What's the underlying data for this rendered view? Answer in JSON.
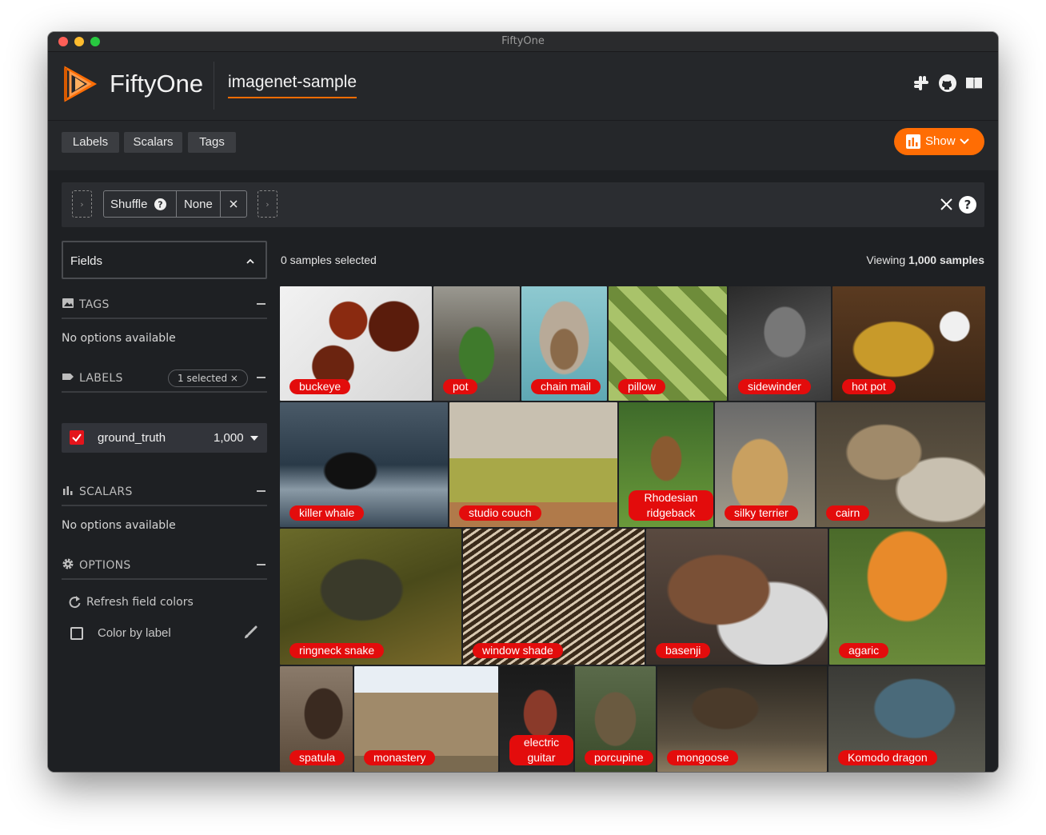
{
  "window": {
    "title": "FiftyOne"
  },
  "header": {
    "brand": "FiftyOne",
    "dataset_name": "imagenet-sample",
    "icons": [
      "slack-icon",
      "github-icon",
      "docs-book-icon"
    ]
  },
  "toolbar": {
    "tabs": [
      "Labels",
      "Scalars",
      "Tags"
    ],
    "show_label": "Show"
  },
  "view_bar": {
    "stage_name": "Shuffle",
    "stage_value": "None"
  },
  "sidebar": {
    "fields_label": "Fields",
    "tags": {
      "title": "TAGS",
      "empty_text": "No options available"
    },
    "labels": {
      "title": "LABELS",
      "badge": "1 selected ×",
      "field_name": "ground_truth",
      "field_count": "1,000"
    },
    "scalars": {
      "title": "SCALARS",
      "empty_text": "No options available"
    },
    "options": {
      "title": "OPTIONS",
      "refresh_label": "Refresh field colors",
      "color_by_label": "Color by label"
    }
  },
  "grid_header": {
    "selected_text": "0 samples selected",
    "viewing_prefix": "Viewing",
    "viewing_count": "1,000 samples"
  },
  "samples": [
    {
      "label": "buckeye"
    },
    {
      "label": "pot"
    },
    {
      "label": "chain mail"
    },
    {
      "label": "pillow"
    },
    {
      "label": "sidewinder"
    },
    {
      "label": "hot pot"
    },
    {
      "label": "killer whale"
    },
    {
      "label": "studio couch"
    },
    {
      "label": "Rhodesian ridgeback"
    },
    {
      "label": "silky terrier"
    },
    {
      "label": "cairn"
    },
    {
      "label": "ringneck snake"
    },
    {
      "label": "window shade"
    },
    {
      "label": "basenji"
    },
    {
      "label": "agaric"
    },
    {
      "label": "spatula"
    },
    {
      "label": "monastery"
    },
    {
      "label": "electric guitar"
    },
    {
      "label": "porcupine"
    },
    {
      "label": "mongoose"
    },
    {
      "label": "Komodo dragon"
    }
  ],
  "colors": {
    "accent": "#ff6d04",
    "label_red": "#e30c0c",
    "background": "#25272a"
  }
}
